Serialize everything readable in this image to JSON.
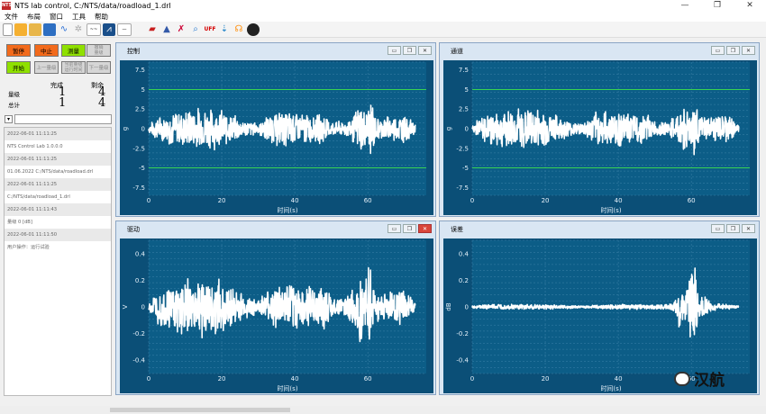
{
  "window": {
    "logo": "NTS",
    "title": "NTS lab control, C:/NTS/data/roadload_1.drl"
  },
  "menu": [
    "文件",
    "布局",
    "窗口",
    "工具",
    "帮助"
  ],
  "controls": {
    "pause": "暂停",
    "abort": "中止",
    "measure": "测量",
    "undo_l1": "撤销",
    "undo_l2": "量级",
    "start": "开始",
    "prev": "上一量级",
    "next_l1": "当前量级",
    "next_l2": "运行时间",
    "next_level": "下一量级",
    "colors": {
      "pause": "#f26a1b",
      "abort": "#f26a1b",
      "measure": "#8fe000",
      "start": "#8fe000",
      "disabled": "#d6d6d6"
    }
  },
  "stats": {
    "done_header": "完成",
    "left_header": "剩余",
    "level_label": "量级",
    "total_label": "总计",
    "level_done": "1",
    "level_left": "4",
    "total_done": "1",
    "total_left": "4"
  },
  "log": [
    "2022-06-01 11:11:25",
    "NTS Control Lab 1.0.0.0",
    "2022-06-01 11:11:25",
    "01.06.2022 C:/NTS/data/roadload.drl",
    "2022-06-01 11:11:25",
    "C:/NTS/data/roadload_1.drl",
    "2022-06-01 11:11:43",
    "量级                      0 [dB]",
    "2022-06-01 11:11:50",
    "用户操作：运行试验"
  ],
  "panels": [
    {
      "title": "控制",
      "close_red": false
    },
    {
      "title": "通道",
      "close_red": false
    },
    {
      "title": "驱动",
      "close_red": true
    },
    {
      "title": "误差",
      "close_red": false
    }
  ],
  "chart_data": [
    {
      "type": "line",
      "title": "控制",
      "xlabel": "时间(s)",
      "ylabel": "g",
      "xlim": [
        0,
        76
      ],
      "ylim": [
        -8.5,
        8.5
      ],
      "xticks": [
        0,
        20,
        40,
        60
      ],
      "yticks": [
        -7.5,
        -5,
        -2.5,
        0,
        2.5,
        5,
        7.5
      ],
      "reference_lines": [
        5,
        -5
      ],
      "series": [
        {
          "envelope": [
            [
              0,
              0.5
            ],
            [
              2,
              1.5
            ],
            [
              6,
              2.3
            ],
            [
              10,
              2.6
            ],
            [
              14,
              3.0
            ],
            [
              20,
              2.6
            ],
            [
              26,
              1.2
            ],
            [
              30,
              0.8
            ],
            [
              34,
              2.3
            ],
            [
              40,
              2.5
            ],
            [
              45,
              1.8
            ],
            [
              48,
              2.2
            ],
            [
              50,
              1.0
            ],
            [
              54,
              1.0
            ],
            [
              57,
              2.6
            ],
            [
              58,
              4.0
            ],
            [
              59,
              2.5
            ],
            [
              61,
              4.8
            ],
            [
              62,
              1.6
            ],
            [
              66,
              1.8
            ],
            [
              70,
              2.0
            ],
            [
              72,
              1.2
            ],
            [
              73,
              0.6
            ]
          ]
        }
      ],
      "colors": {
        "line": "#ffffff",
        "reference": "#39d353",
        "background": "#0c5d87"
      }
    },
    {
      "type": "line",
      "title": "通道",
      "xlabel": "时间(s)",
      "ylabel": "g",
      "xlim": [
        0,
        76
      ],
      "ylim": [
        -8.5,
        8.5
      ],
      "xticks": [
        0,
        20,
        40,
        60
      ],
      "yticks": [
        -7.5,
        -5,
        -2.5,
        0,
        2.5,
        5,
        7.5
      ],
      "reference_lines": [
        5,
        -5
      ],
      "series": [
        {
          "envelope": [
            [
              0,
              0.5
            ],
            [
              2,
              1.5
            ],
            [
              6,
              2.3
            ],
            [
              10,
              2.6
            ],
            [
              14,
              3.0
            ],
            [
              20,
              2.6
            ],
            [
              26,
              1.2
            ],
            [
              30,
              0.8
            ],
            [
              34,
              2.3
            ],
            [
              40,
              2.5
            ],
            [
              45,
              1.8
            ],
            [
              48,
              2.2
            ],
            [
              50,
              1.0
            ],
            [
              54,
              1.0
            ],
            [
              57,
              2.6
            ],
            [
              58,
              4.0
            ],
            [
              59,
              2.5
            ],
            [
              61,
              4.8
            ],
            [
              62,
              1.6
            ],
            [
              66,
              1.8
            ],
            [
              70,
              2.0
            ],
            [
              72,
              1.2
            ],
            [
              73,
              0.6
            ]
          ]
        }
      ],
      "colors": {
        "line": "#ffffff",
        "reference": "#39d353",
        "background": "#0c5d87"
      }
    },
    {
      "type": "line",
      "title": "驱动",
      "xlabel": "时间(s)",
      "ylabel": "V",
      "xlim": [
        0,
        76
      ],
      "ylim": [
        -0.5,
        0.5
      ],
      "xticks": [
        0,
        20,
        40,
        60
      ],
      "yticks": [
        -0.4,
        -0.2,
        0,
        0.2,
        0.4
      ],
      "reference_lines": [],
      "series": [
        {
          "envelope": [
            [
              0,
              0.03
            ],
            [
              2,
              0.12
            ],
            [
              6,
              0.2
            ],
            [
              10,
              0.22
            ],
            [
              14,
              0.26
            ],
            [
              20,
              0.22
            ],
            [
              26,
              0.1
            ],
            [
              30,
              0.06
            ],
            [
              34,
              0.17
            ],
            [
              40,
              0.2
            ],
            [
              45,
              0.15
            ],
            [
              48,
              0.18
            ],
            [
              50,
              0.08
            ],
            [
              54,
              0.08
            ],
            [
              57,
              0.22
            ],
            [
              58,
              0.32
            ],
            [
              59,
              0.2
            ],
            [
              61,
              0.4
            ],
            [
              62,
              0.12
            ],
            [
              66,
              0.14
            ],
            [
              70,
              0.14
            ],
            [
              72,
              0.08
            ],
            [
              73,
              0.04
            ]
          ]
        }
      ],
      "colors": {
        "line": "#ffffff",
        "background": "#0c5d87"
      }
    },
    {
      "type": "line",
      "title": "误差",
      "xlabel": "时间(s)",
      "ylabel": "dB",
      "xlim": [
        0,
        76
      ],
      "ylim": [
        -0.5,
        0.5
      ],
      "xticks": [
        0,
        20,
        40,
        60
      ],
      "yticks": [
        -0.4,
        -0.2,
        0,
        0.2,
        0.4
      ],
      "reference_lines": [],
      "series": [
        {
          "envelope": [
            [
              0,
              0.01
            ],
            [
              4,
              0.02
            ],
            [
              10,
              0.02
            ],
            [
              20,
              0.02
            ],
            [
              30,
              0.01
            ],
            [
              40,
              0.02
            ],
            [
              48,
              0.02
            ],
            [
              54,
              0.02
            ],
            [
              56,
              0.06
            ],
            [
              57,
              0.22
            ],
            [
              58,
              0.08
            ],
            [
              60,
              0.3
            ],
            [
              61,
              0.42
            ],
            [
              62,
              0.12
            ],
            [
              66,
              0.03
            ],
            [
              70,
              0.02
            ],
            [
              73,
              0.01
            ]
          ]
        }
      ],
      "colors": {
        "line": "#ffffff",
        "background": "#0c5d87"
      }
    }
  ],
  "watermark": "汉航"
}
